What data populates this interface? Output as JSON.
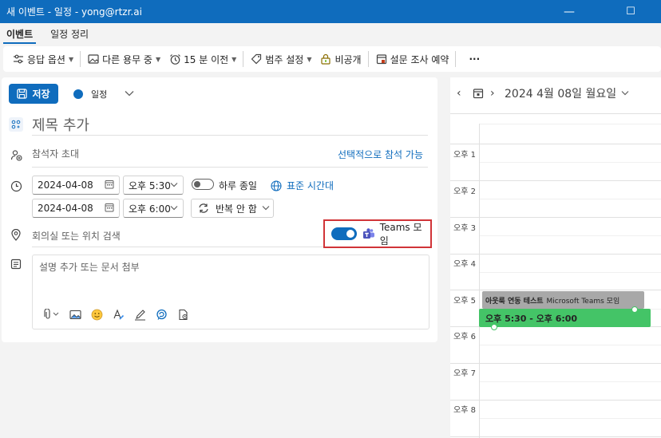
{
  "window": {
    "title": "새 이벤트 - 일정 - yong@rtzr.ai",
    "minimize": "—",
    "maximize": "☐",
    "close": "✕"
  },
  "tabs": [
    {
      "label": "이벤트",
      "active": true
    },
    {
      "label": "일정 정리",
      "active": false
    }
  ],
  "ribbon": {
    "response": "응답 옵션",
    "busy": "다른 용무 중",
    "reminder": "15 분 이전",
    "category": "범주 설정",
    "private": "비공개",
    "poll": "설문 조사 예약",
    "more": "···"
  },
  "form": {
    "save_label": "저장",
    "calendar_name": "일정",
    "title_placeholder": "제목 추가",
    "attendees_placeholder": "참석자 초대",
    "optional_link": "선택적으로 참석 가능",
    "start_date": "2024-04-08",
    "start_time": "오후 5:30",
    "end_date": "2024-04-08",
    "end_time": "오후 6:00",
    "allday_label": "하루 종일",
    "timezone_label": "표준 시간대",
    "repeat_label": "반복 안 함",
    "location_placeholder": "회의실 또는 위치 검색",
    "teams_label": "Teams 모임",
    "teams_on": true,
    "description_placeholder": "설명 추가 또는 문서 첨부"
  },
  "dayview": {
    "date_label": "2024 4월 08일 월요일",
    "hours": [
      "오후 1",
      "오후 2",
      "오후 3",
      "오후 4",
      "오후 5",
      "오후 6",
      "오후 7",
      "오후 8"
    ],
    "existing_event_title": "아웃룩 연동 테스트",
    "existing_event_sub": "Microsoft Teams 모임",
    "new_event_time": "오후 5:30 - 오후 6:00"
  },
  "colors": {
    "accent": "#0f6cbd",
    "new_event": "#44c467",
    "existing_event": "#a8a8a8",
    "highlight_box": "#d13438"
  }
}
